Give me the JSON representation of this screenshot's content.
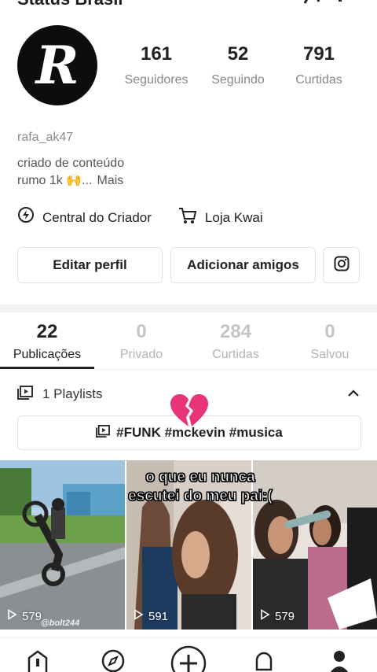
{
  "header": {
    "title": "Status Brasil"
  },
  "profile": {
    "avatar_letter": "R",
    "stats": [
      {
        "value": "161",
        "label": "Seguidores"
      },
      {
        "value": "52",
        "label": "Seguindo"
      },
      {
        "value": "791",
        "label": "Curtidas"
      }
    ],
    "username": "rafa_ak47",
    "bio_line1": "criado de conteúdo",
    "bio_line2": "rumo 1k 🙌...",
    "bio_more": "Mais"
  },
  "links": [
    {
      "label": "Central do Criador",
      "icon": "bolt-pin-icon"
    },
    {
      "label": "Loja Kwai",
      "icon": "cart-icon"
    }
  ],
  "buttons": {
    "edit_profile": "Editar perfil",
    "add_friends": "Adicionar amigos",
    "instagram_icon": "instagram-icon"
  },
  "tabs": [
    {
      "count": "22",
      "label": "Publicações",
      "active": true
    },
    {
      "count": "0",
      "label": "Privado",
      "active": false
    },
    {
      "count": "284",
      "label": "Curtidas",
      "active": false
    },
    {
      "count": "0",
      "label": "Salvou",
      "active": false
    }
  ],
  "playlists": {
    "label": "1 Playlists",
    "tag_line": "#FUNK #mckevin #musica",
    "heart_emoji": "broken-heart"
  },
  "videos": [
    {
      "plays": "579",
      "watermark": "@bolt244"
    },
    {
      "plays": "591"
    },
    {
      "plays": "579"
    }
  ],
  "overlay_caption": {
    "line1": "o que eu nunca",
    "line2": "escutei do meu pai:("
  },
  "nav": [
    "home-icon",
    "discover-icon",
    "create-icon",
    "notifications-icon",
    "profile-icon"
  ],
  "colors": {
    "text": "#222222",
    "muted": "#888888",
    "border": "#e2e2e2",
    "divider": "#f3f3f3",
    "heart": "#e8357a"
  }
}
